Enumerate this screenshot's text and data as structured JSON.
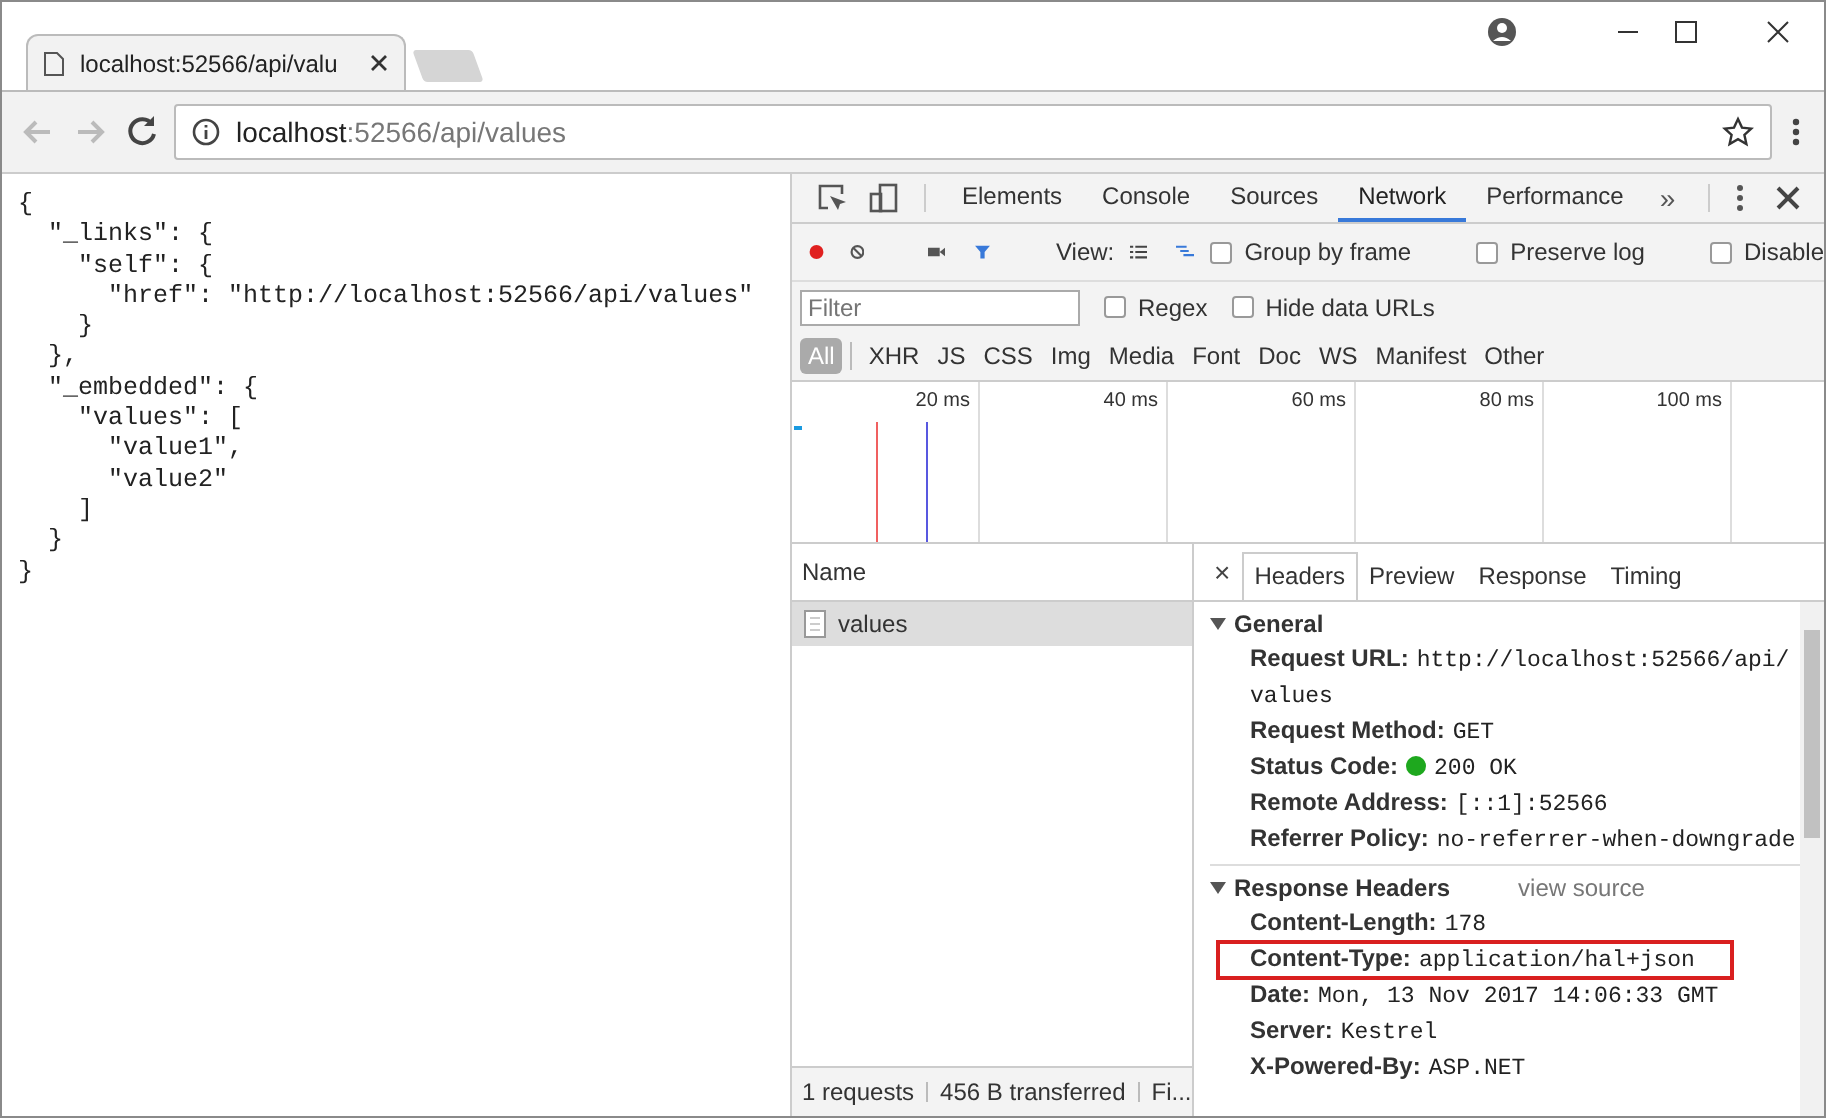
{
  "browser": {
    "tab": {
      "title": "localhost:52566/api/valu"
    },
    "address": {
      "host": "localhost",
      "path": ":52566/api/values"
    }
  },
  "page": {
    "json_lines": [
      {
        "text": "{",
        "children": [
          {
            "text": "\"_links\": {",
            "children": [
              {
                "text": "\"self\": {",
                "children": [
                  {
                    "text": "\"href\": \"http://localhost:52566/api/values\""
                  }
                ]
              },
              {
                "text": "}"
              }
            ]
          },
          {
            "text": "},"
          },
          {
            "text": "\"_embedded\": {",
            "children": [
              {
                "text": "\"values\": [",
                "children": [
                  {
                    "text": "\"value1\","
                  },
                  {
                    "text": "\"value2\""
                  }
                ]
              },
              {
                "text": "]"
              }
            ]
          },
          {
            "text": "}"
          }
        ]
      },
      {
        "text": "}"
      }
    ]
  },
  "devtools": {
    "panel_tabs": [
      {
        "label": "Elements",
        "selected": false
      },
      {
        "label": "Console",
        "selected": false
      },
      {
        "label": "Sources",
        "selected": false
      },
      {
        "label": "Network",
        "selected": true
      },
      {
        "label": "Performance",
        "selected": false
      }
    ],
    "overflow": "»",
    "toolbar": {
      "view_label": "View:",
      "checkboxes": [
        {
          "label": "Group by frame",
          "checked": false
        },
        {
          "label": "Preserve log",
          "checked": false
        },
        {
          "label": "Disable",
          "checked": false
        }
      ]
    },
    "filter": {
      "placeholder": "Filter",
      "checkboxes": [
        {
          "label": "Regex",
          "checked": false
        },
        {
          "label": "Hide data URLs",
          "checked": false
        }
      ]
    },
    "type_filters": [
      {
        "label": "All",
        "selected": true
      },
      {
        "label": "XHR",
        "selected": false
      },
      {
        "label": "JS",
        "selected": false
      },
      {
        "label": "CSS",
        "selected": false
      },
      {
        "label": "Img",
        "selected": false
      },
      {
        "label": "Media",
        "selected": false
      },
      {
        "label": "Font",
        "selected": false
      },
      {
        "label": "Doc",
        "selected": false
      },
      {
        "label": "WS",
        "selected": false
      },
      {
        "label": "Manifest",
        "selected": false
      },
      {
        "label": "Other",
        "selected": false
      }
    ],
    "timeline_ticks": [
      "20 ms",
      "40 ms",
      "60 ms",
      "80 ms",
      "100 ms"
    ],
    "requests": {
      "column": "Name",
      "rows": [
        {
          "name": "values",
          "selected": true
        }
      ],
      "status": [
        "1 requests",
        "456 B transferred",
        "Fi..."
      ]
    },
    "details": {
      "close": "×",
      "tabs": [
        {
          "label": "Headers",
          "selected": true
        },
        {
          "label": "Preview",
          "selected": false
        },
        {
          "label": "Response",
          "selected": false
        },
        {
          "label": "Timing",
          "selected": false
        }
      ],
      "sections": [
        {
          "title": "General",
          "expanded": true,
          "rows": [
            {
              "name": "Request URL:",
              "value": "http://localhost:52566/api/values",
              "highlighted": false
            },
            {
              "name": "Request Method:",
              "value": "GET",
              "highlighted": false
            },
            {
              "name": "Status Code:",
              "value": "200 OK",
              "color": "#1ea81e",
              "highlighted": false
            },
            {
              "name": "Remote Address:",
              "value": "[::1]:52566",
              "highlighted": false
            },
            {
              "name": "Referrer Policy:",
              "value": "no-referrer-when-downgrade",
              "highlighted": false
            }
          ]
        },
        {
          "title": "Response Headers",
          "link": "view source",
          "expanded": true,
          "rows": [
            {
              "name": "Content-Length:",
              "value": "178",
              "highlighted": false
            },
            {
              "name": "Content-Type:",
              "value": "application/hal+json",
              "highlighted": true
            },
            {
              "name": "Date:",
              "value": "Mon, 13 Nov 2017 14:06:33 GMT",
              "highlighted": false
            },
            {
              "name": "Server:",
              "value": "Kestrel",
              "highlighted": false
            },
            {
              "name": "X-Powered-By:",
              "value": "ASP.NET",
              "highlighted": false
            }
          ]
        }
      ]
    }
  }
}
